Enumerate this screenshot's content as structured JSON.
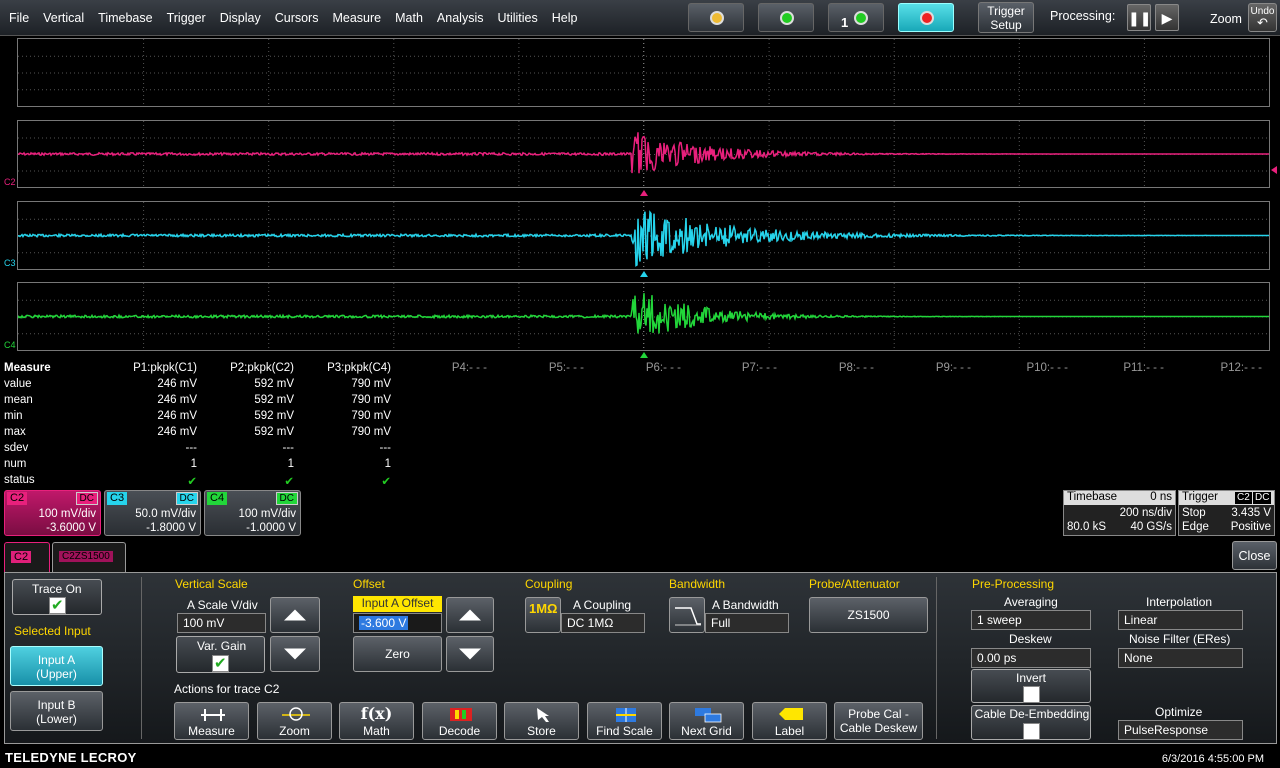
{
  "menu": [
    "File",
    "Vertical",
    "Timebase",
    "Trigger",
    "Display",
    "Cursors",
    "Measure",
    "Math",
    "Analysis",
    "Utilities",
    "Help"
  ],
  "toolbar": {
    "trigger_setup_line1": "Trigger",
    "trigger_setup_line2": "Setup",
    "processing_label": "Processing:",
    "zoom_label": "Zoom",
    "undo_label": "Undo",
    "single_num": "1"
  },
  "channels": {
    "c2": {
      "label": "C2",
      "color": "#e8207c"
    },
    "c3": {
      "label": "C3",
      "color": "#26d4ec"
    },
    "c4": {
      "label": "C4",
      "color": "#22d63a"
    }
  },
  "measure": {
    "title": "Measure",
    "row_labels": [
      "value",
      "mean",
      "min",
      "max",
      "sdev",
      "num",
      "status"
    ],
    "params": [
      {
        "name": "P1:pkpk(C1)",
        "value": "246 mV",
        "mean": "246 mV",
        "min": "246 mV",
        "max": "246 mV",
        "sdev": "---",
        "num": "1",
        "status": "✔"
      },
      {
        "name": "P2:pkpk(C2)",
        "value": "592 mV",
        "mean": "592 mV",
        "min": "592 mV",
        "max": "592 mV",
        "sdev": "---",
        "num": "1",
        "status": "✔"
      },
      {
        "name": "P3:pkpk(C4)",
        "value": "790 mV",
        "mean": "790 mV",
        "min": "790 mV",
        "max": "790 mV",
        "sdev": "---",
        "num": "1",
        "status": "✔"
      }
    ],
    "unused": [
      "P4:- - -",
      "P5:- - -",
      "P6:- - -",
      "P7:- - -",
      "P8:- - -",
      "P9:- - -",
      "P10:- - -",
      "P11:- - -",
      "P12:- - -"
    ]
  },
  "descriptors": [
    {
      "tag": "C2",
      "coupling": "DC",
      "scale": "100 mV/div",
      "offset": "-3.6000 V",
      "color": "#e8207c"
    },
    {
      "tag": "C3",
      "coupling": "DC",
      "scale": "50.0 mV/div",
      "offset": "-1.8000 V",
      "color": "#26d4ec"
    },
    {
      "tag": "C4",
      "coupling": "DC",
      "scale": "100 mV/div",
      "offset": "-1.0000 V",
      "color": "#22d63a"
    }
  ],
  "timebase": {
    "label": "Timebase",
    "delay": "0 ns",
    "per_div": "200 ns/div",
    "samples": "80.0 kS",
    "rate": "40 GS/s"
  },
  "trigger": {
    "label": "Trigger",
    "source": "C2",
    "coupling": "DC",
    "mode": "Stop",
    "level": "3.435 V",
    "type": "Edge",
    "slope": "Positive"
  },
  "dialog": {
    "tab1": "C2",
    "tab2": "C2ZS1500",
    "close": "Close",
    "trace_on": "Trace On",
    "selected_input": "Selected Input",
    "input_a": [
      "Input A",
      "(Upper)"
    ],
    "input_b": [
      "Input B",
      "(Lower)"
    ],
    "vertical_scale": "Vertical Scale",
    "a_scale_label": "A Scale V/div",
    "a_scale_value": "100 mV",
    "var_gain": "Var. Gain",
    "offset": "Offset",
    "input_a_offset": "Input A Offset",
    "offset_value": "-3.600 V",
    "zero": "Zero",
    "coupling": "Coupling",
    "coupling_icon": "1MΩ",
    "a_coupling_label": "A Coupling",
    "a_coupling_value": "DC 1MΩ",
    "bandwidth": "Bandwidth",
    "a_bandwidth_label": "A Bandwidth",
    "a_bandwidth_value": "Full",
    "probe": "Probe/Attenuator",
    "probe_value": "ZS1500",
    "preprocessing": "Pre-Processing",
    "averaging_label": "Averaging",
    "averaging_value": "1 sweep",
    "interpolation_label": "Interpolation",
    "interpolation_value": "Linear",
    "deskew_label": "Deskew",
    "deskew_value": "0.00 ps",
    "noise_filter_label": "Noise Filter (ERes)",
    "noise_filter_value": "None",
    "invert": "Invert",
    "cable_deembed": "Cable De-Embedding",
    "optimize_label": "Optimize",
    "optimize_value": "PulseResponse",
    "actions_label": "Actions for trace C2",
    "actions": [
      "Measure",
      "Zoom",
      "Math",
      "Decode",
      "Store",
      "Find Scale",
      "Next Grid",
      "Label"
    ],
    "probe_cal": [
      "Probe Cal -",
      "Cable Deskew"
    ]
  },
  "footer": {
    "brand": "TELEDYNE LECROY",
    "datetime": "6/3/2016 4:55:00 PM"
  }
}
